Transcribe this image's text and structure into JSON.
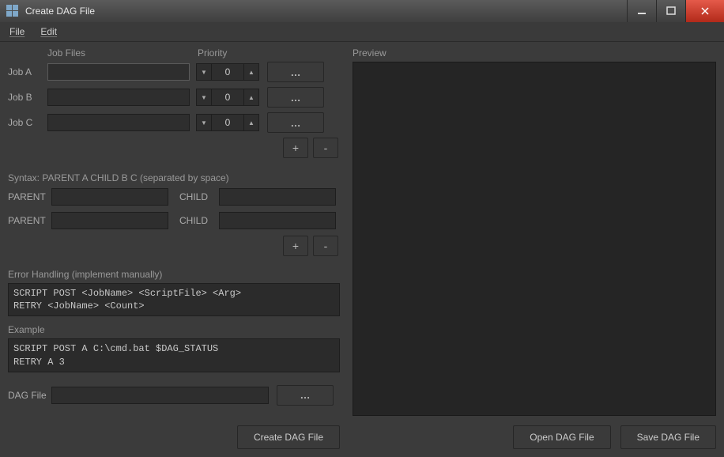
{
  "window": {
    "title": "Create DAG File"
  },
  "menu": {
    "file": "File",
    "edit": "Edit"
  },
  "headers": {
    "jobFiles": "Job Files",
    "priority": "Priority",
    "preview": "Preview"
  },
  "jobs": [
    {
      "label": "Job A",
      "file": "",
      "priority": "0",
      "browse": "…"
    },
    {
      "label": "Job B",
      "file": "",
      "priority": "0",
      "browse": "…"
    },
    {
      "label": "Job C",
      "file": "",
      "priority": "0",
      "browse": "…"
    }
  ],
  "buttons": {
    "add": "+",
    "remove": "-"
  },
  "syntaxLabel": "Syntax: PARENT A CHILD B C (separated by space)",
  "pcRows": [
    {
      "parentLabel": "PARENT",
      "parentValue": "",
      "childLabel": "CHILD",
      "childValue": ""
    },
    {
      "parentLabel": "PARENT",
      "parentValue": "",
      "childLabel": "CHILD",
      "childValue": ""
    }
  ],
  "errorHandling": {
    "label": "Error Handling (implement manually)",
    "text": "SCRIPT POST <JobName> <ScriptFile> <Arg>\nRETRY <JobName> <Count>"
  },
  "example": {
    "label": "Example",
    "text": "SCRIPT POST A C:\\cmd.bat $DAG_STATUS\nRETRY A 3"
  },
  "dagFile": {
    "label": "DAG File",
    "value": "",
    "browse": "…"
  },
  "actions": {
    "createDag": "Create DAG File",
    "openDag": "Open DAG File",
    "saveDag": "Save DAG File"
  }
}
